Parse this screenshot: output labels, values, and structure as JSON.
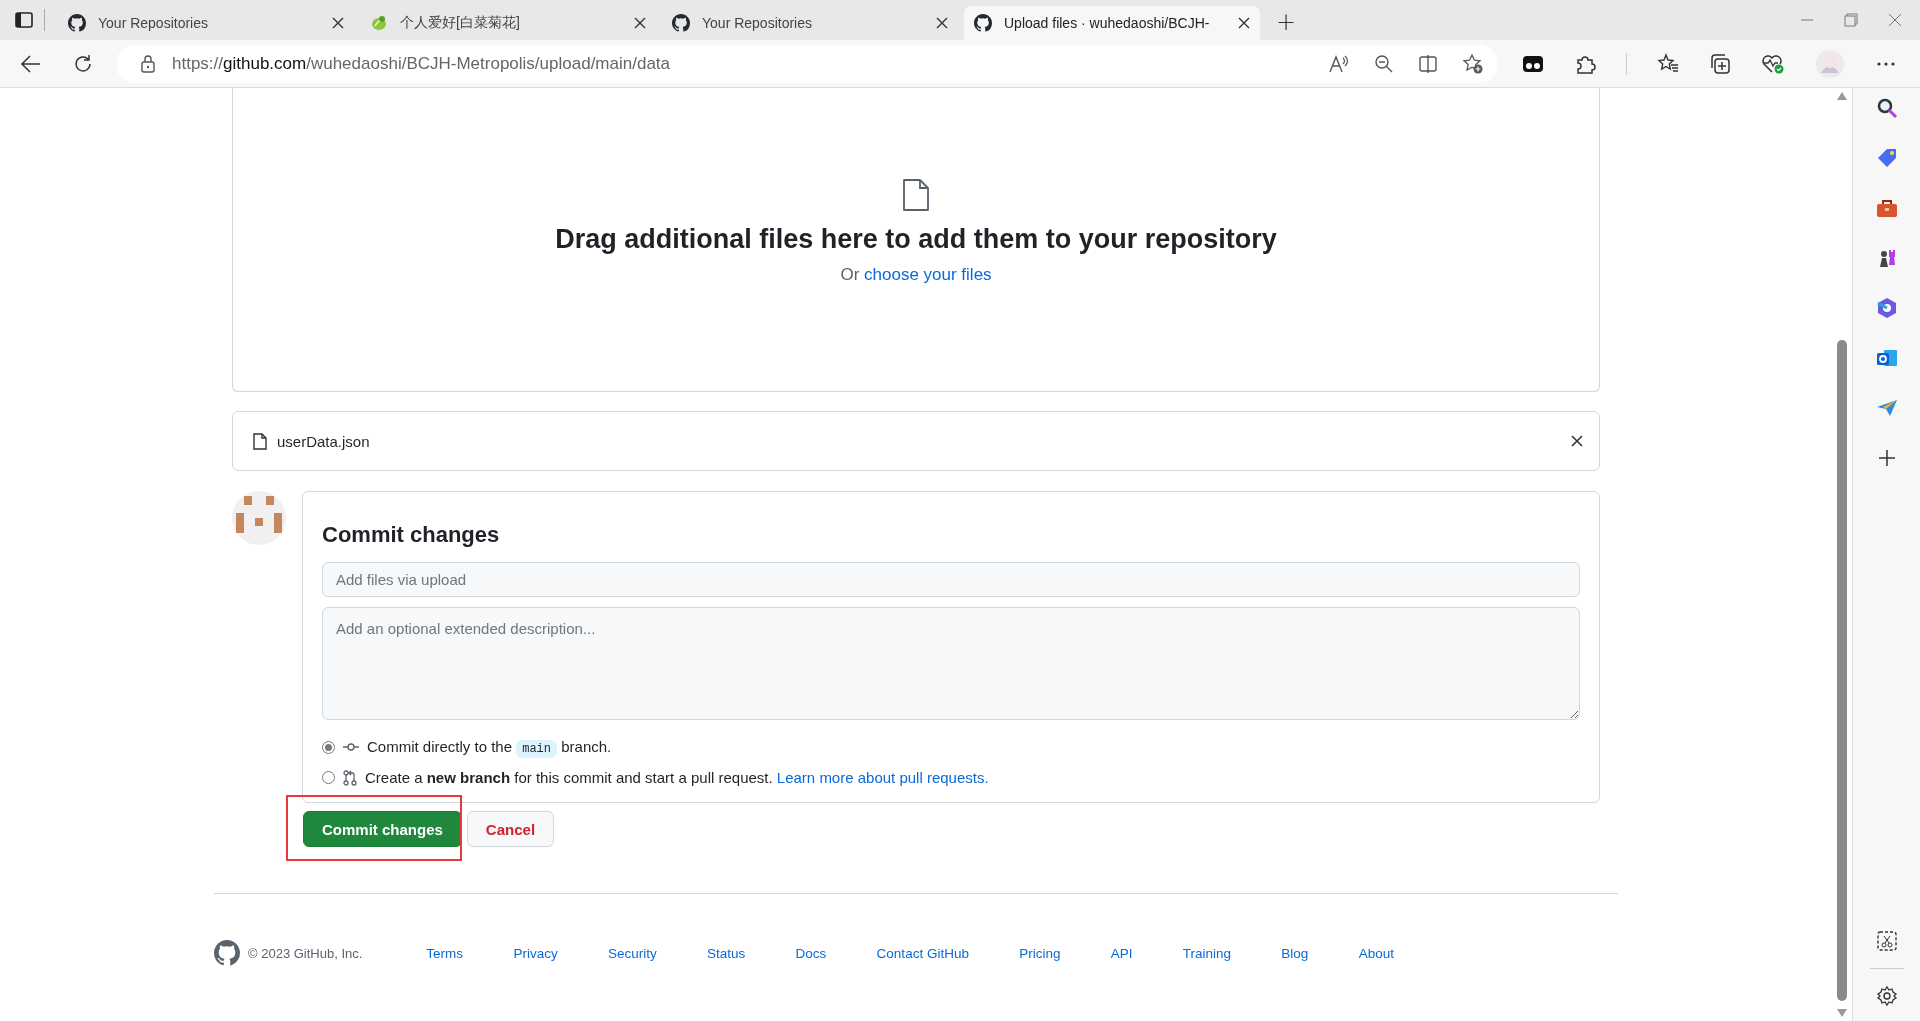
{
  "browser": {
    "tabs": [
      {
        "title": "Your Repositories",
        "kind": "github",
        "selected": false
      },
      {
        "title": "个人爱好[白菜菊花]",
        "kind": "cabbage",
        "selected": false
      },
      {
        "title": "Your Repositories",
        "kind": "github",
        "selected": false
      },
      {
        "title": "Upload files · wuhedaoshi/BCJH-",
        "kind": "github",
        "selected": true
      }
    ],
    "new_tab": "+",
    "address": {
      "scheme": "https://",
      "host": "github.com",
      "path": "/wuhedaoshi/BCJH-Metropolis/upload/main/data"
    }
  },
  "dropzone": {
    "heading": "Drag additional files here to add them to your repository",
    "prefix": "Or",
    "link": "choose your files"
  },
  "files": [
    {
      "name": "userData.json"
    }
  ],
  "commit": {
    "title": "Commit changes",
    "summary": {
      "placeholder": "Add files via upload"
    },
    "description": {
      "placeholder": "Add an optional extended description..."
    },
    "options": [
      {
        "kind": "direct",
        "selected": true,
        "before": "Commit directly to the",
        "branch": "main",
        "after": "branch."
      },
      {
        "kind": "new-branch",
        "selected": false,
        "text": "Create a **new branch** for this commit and start a pull request.",
        "link": "Learn more about pull requests."
      }
    ],
    "buttons": [
      {
        "kind": "primary",
        "label": "Commit changes",
        "highlighted": true
      },
      {
        "kind": "cancel",
        "label": "Cancel",
        "highlighted": false
      }
    ]
  },
  "footer": {
    "copyright": "© 2023 GitHub, Inc.",
    "links": [
      "Terms",
      "Privacy",
      "Security",
      "Status",
      "Docs",
      "Contact GitHub",
      "Pricing",
      "API",
      "Training",
      "Blog",
      "About"
    ]
  }
}
